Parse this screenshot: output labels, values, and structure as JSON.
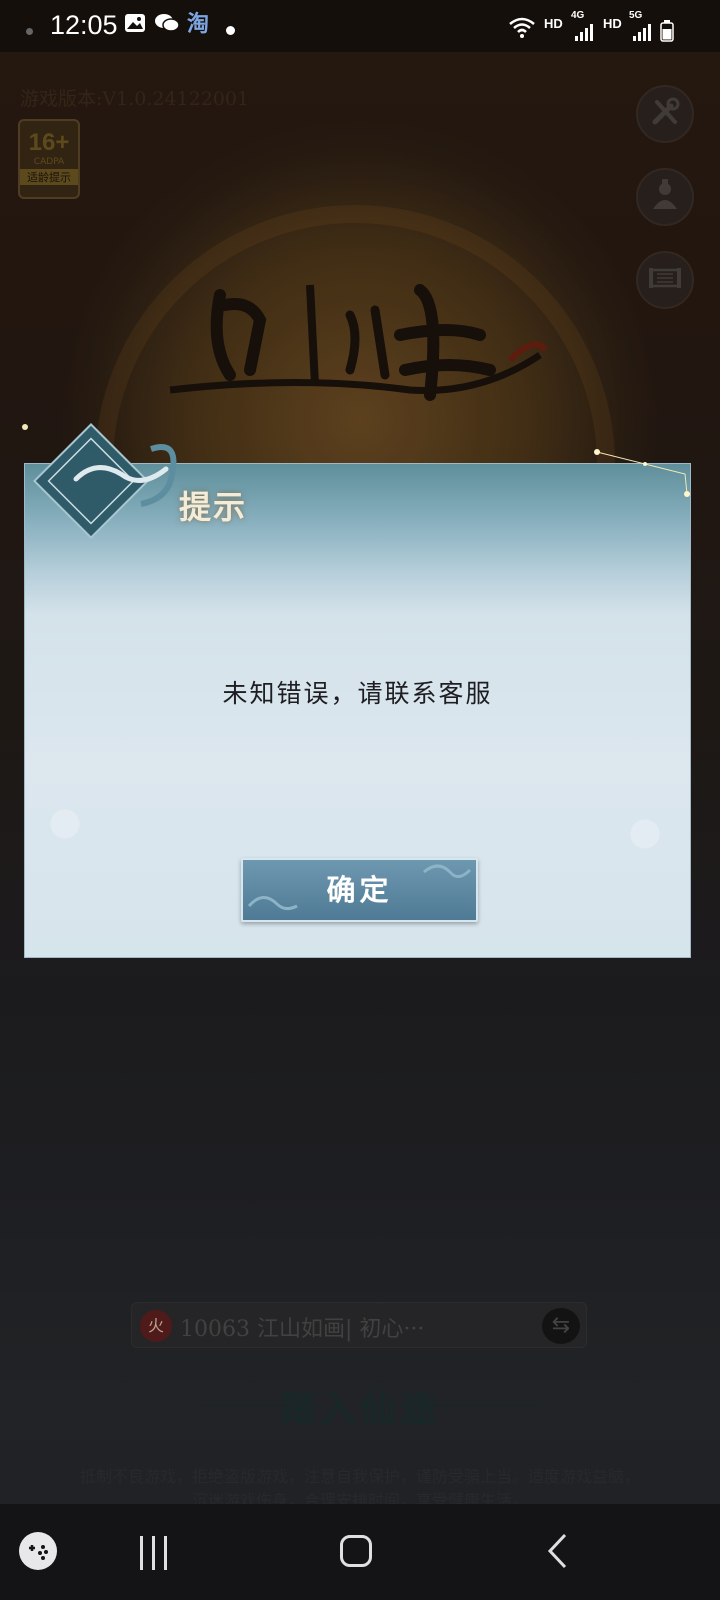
{
  "status_bar": {
    "time": "12:05",
    "left_icons": [
      "image-icon",
      "wechat-icon",
      "taobao-icon",
      "dot-icon"
    ],
    "taobao_glyph": "淘",
    "network_1": "HD",
    "network_2": "4G",
    "network_3": "HD",
    "network_4": "5G"
  },
  "game": {
    "version_text": "游戏版本:V1.0.24122001",
    "age_badge": {
      "rating": "16+",
      "org": "CADPA",
      "tip": "适龄提示"
    },
    "side_buttons": [
      "settings-icon",
      "character-icon",
      "scroll-icon"
    ],
    "server": {
      "number": "10063",
      "name": "江山如画",
      "sub": "初心···"
    },
    "enter_button": "踏入仙途",
    "notice": "抵制不良游戏，拒绝盗版游戏，注意自我保护，谨防受骗上当。适度游戏益脑，沉迷游戏伤身，合理安排时间，享受健康生活。"
  },
  "dialog": {
    "title": "提示",
    "message": "未知错误，请联系客服",
    "confirm_label": "确定"
  },
  "nav_bar": {
    "icons": [
      "game-launcher-icon",
      "recent-apps-icon",
      "home-icon",
      "back-icon"
    ]
  },
  "colors": {
    "dialog_top": "#5f8f9b",
    "dialog_body": "#dce7ee",
    "button": "#5a86a0",
    "title_text": "#f4ecd6"
  }
}
